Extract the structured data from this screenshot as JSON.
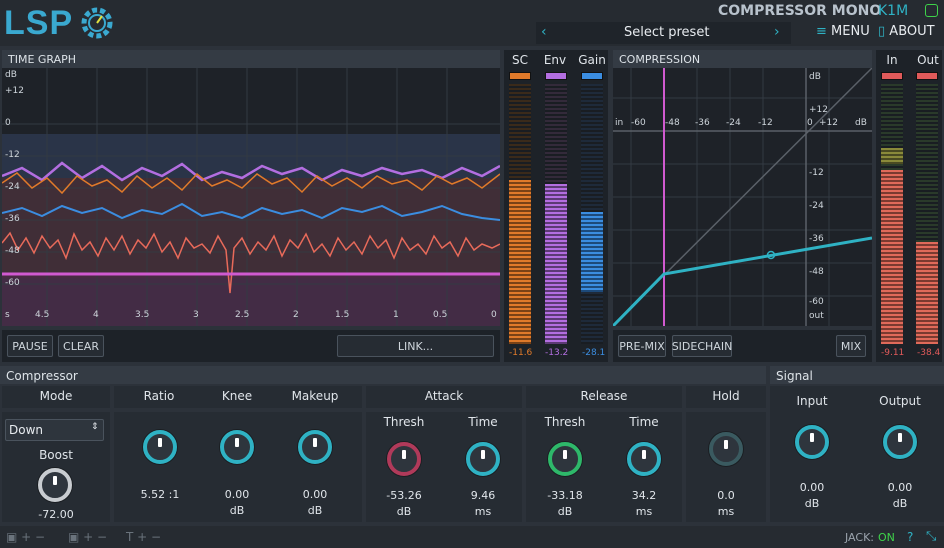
{
  "header": {
    "logo": "LSP",
    "title": "COMPRESSOR MONO",
    "badge": "K1M",
    "preset": "Select preset",
    "menu": "MENU",
    "about": "ABOUT"
  },
  "time_graph": {
    "title": "TIME GRAPH",
    "db_labels": [
      "dB",
      "+12",
      "0",
      "-12",
      "-24",
      "-36",
      "-48",
      "-60"
    ],
    "time_labels": [
      "s",
      "4.5",
      "4",
      "3.5",
      "3",
      "2.5",
      "2",
      "1.5",
      "1",
      "0.5",
      "0"
    ],
    "pause": "PAUSE",
    "clear": "CLEAR",
    "link": "LINK..."
  },
  "meters": {
    "sc": {
      "label": "SC",
      "value": "-11.6",
      "color": "#e07a2a"
    },
    "env": {
      "label": "Env",
      "value": "-13.2",
      "color": "#b36ee0"
    },
    "gain": {
      "label": "Gain",
      "value": "-28.1",
      "color": "#3b8de0"
    },
    "in": {
      "label": "In",
      "value": "-9.11",
      "color": "#e05a5a"
    },
    "out": {
      "label": "Out",
      "value": "-38.4",
      "color": "#e05a5a"
    }
  },
  "compression": {
    "title": "COMPRESSION",
    "x_labels": [
      "in",
      "-60",
      "-48",
      "-36",
      "-24",
      "-12",
      "0",
      "+12",
      "dB"
    ],
    "y_labels": [
      "dB",
      "+12",
      "0",
      "-12",
      "-24",
      "-36",
      "-48",
      "-60",
      "out"
    ],
    "premix": "PRE-MIX",
    "sidechain": "SIDECHAIN",
    "mix": "MIX"
  },
  "compressor": {
    "title": "Compressor",
    "mode_label": "Mode",
    "mode_value": "Down",
    "boost_label": "Boost",
    "boost_value": "-72.00",
    "ratio": {
      "label": "Ratio",
      "value": "5.52 :1"
    },
    "knee": {
      "label": "Knee",
      "value": "0.00",
      "unit": "dB"
    },
    "makeup": {
      "label": "Makeup",
      "value": "0.00",
      "unit": "dB"
    },
    "attack": {
      "label": "Attack",
      "thresh_label": "Thresh",
      "thresh": "-53.26",
      "thresh_unit": "dB",
      "time_label": "Time",
      "time": "9.46",
      "time_unit": "ms"
    },
    "release": {
      "label": "Release",
      "thresh_label": "Thresh",
      "thresh": "-33.18",
      "thresh_unit": "dB",
      "time_label": "Time",
      "time": "34.2",
      "time_unit": "ms"
    },
    "hold": {
      "label": "Hold",
      "value": "0.0",
      "unit": "ms"
    }
  },
  "signal": {
    "title": "Signal",
    "input_label": "Input",
    "input_value": "0.00",
    "input_unit": "dB",
    "output_label": "Output",
    "output_value": "0.00",
    "output_unit": "dB"
  },
  "footer": {
    "jack_label": "JACK:",
    "jack_status": "ON"
  }
}
